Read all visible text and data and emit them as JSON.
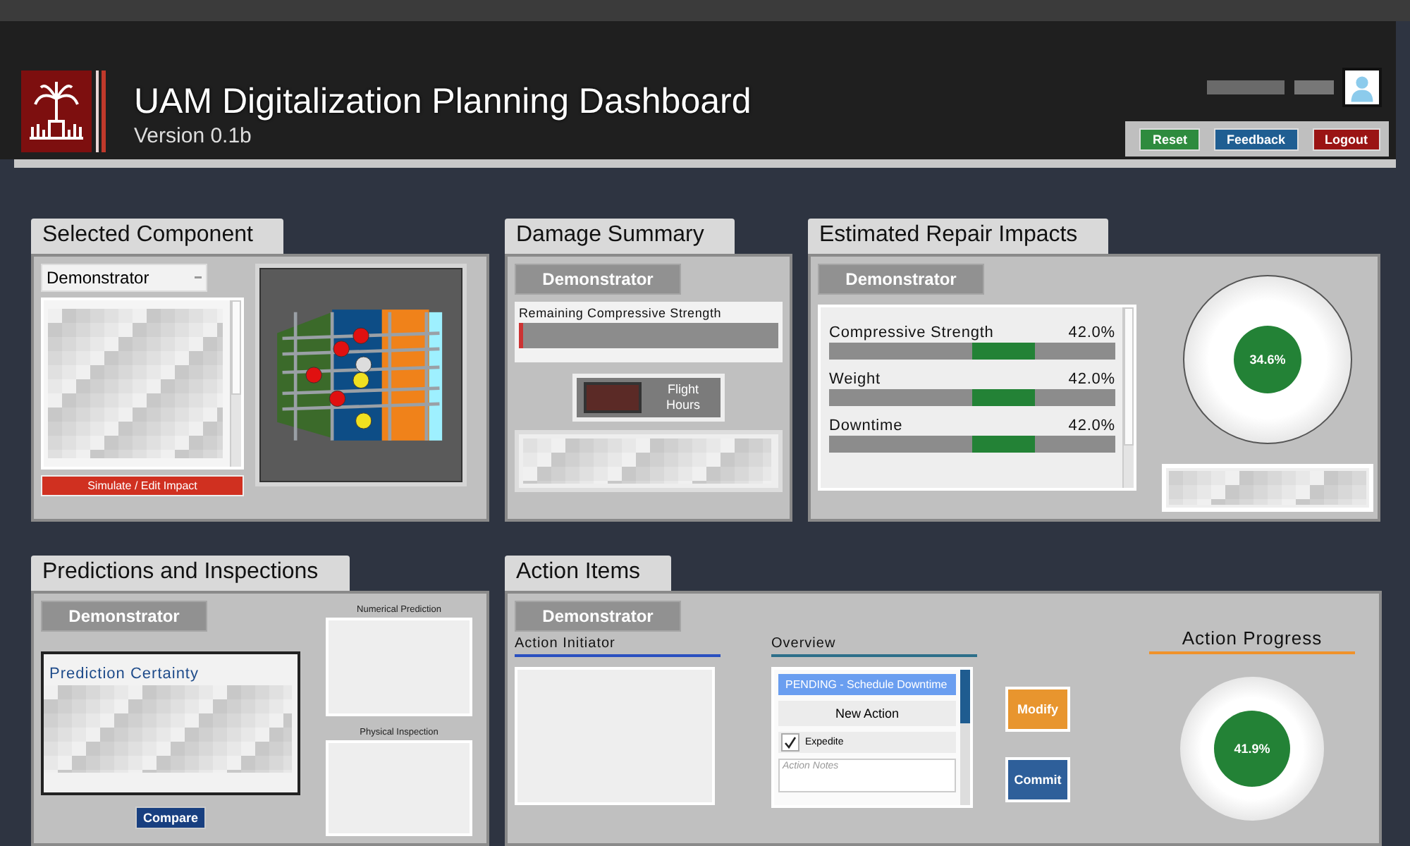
{
  "header": {
    "title": "UAM Digitalization Planning Dashboard",
    "version": "Version 0.1b"
  },
  "header_buttons": [
    {
      "label": "Reset",
      "color": "#2e8b3e"
    },
    {
      "label": "Feedback",
      "color": "#1f5e92"
    },
    {
      "label": "Logout",
      "color": "#9a1414"
    }
  ],
  "selected_component": {
    "title": "Selected Component",
    "dropdown": "Demonstrator",
    "button": "Simulate / Edit Impact"
  },
  "damage_summary": {
    "title": "Damage Summary",
    "component": "Demonstrator",
    "metric": "Remaining Compressive Strength",
    "flight_hours_label": "Flight Hours"
  },
  "estimated_repair_impacts": {
    "title": "Estimated Repair Impacts",
    "component": "Demonstrator",
    "impacts": [
      {
        "name": "Compressive Strength",
        "value": "42.0%",
        "level": 0.72
      },
      {
        "name": "Weight",
        "value": "42.0%",
        "level": 0.72
      },
      {
        "name": "Downtime",
        "value": "42.0%",
        "level": 0.72
      }
    ],
    "gauge": "34.6%"
  },
  "predictions_and_inspections": {
    "title": "Predictions and Inspections",
    "component": "Demonstrator",
    "certainty_heading": "Prediction Certainty",
    "button": "Compare",
    "numerical_label": "Numerical Prediction",
    "physical_label": "Physical Inspection"
  },
  "action_items": {
    "title": "Action Items",
    "component": "Demonstrator",
    "initiator_heading": "Action Initiator",
    "overview_heading": "Overview",
    "overview_items": [
      {
        "label": "PENDING - Schedule Downtime",
        "selected": true
      }
    ],
    "new_action": "New Action",
    "expedite": {
      "label": "Expedite",
      "checked": true
    },
    "notes_placeholder": "Action Notes",
    "buttons": [
      {
        "label": "Modify",
        "color": "#e8952e"
      },
      {
        "label": "Commit",
        "color": "#2e5f9a"
      }
    ],
    "progress_heading": "Action Progress",
    "progress": "41.9%"
  }
}
